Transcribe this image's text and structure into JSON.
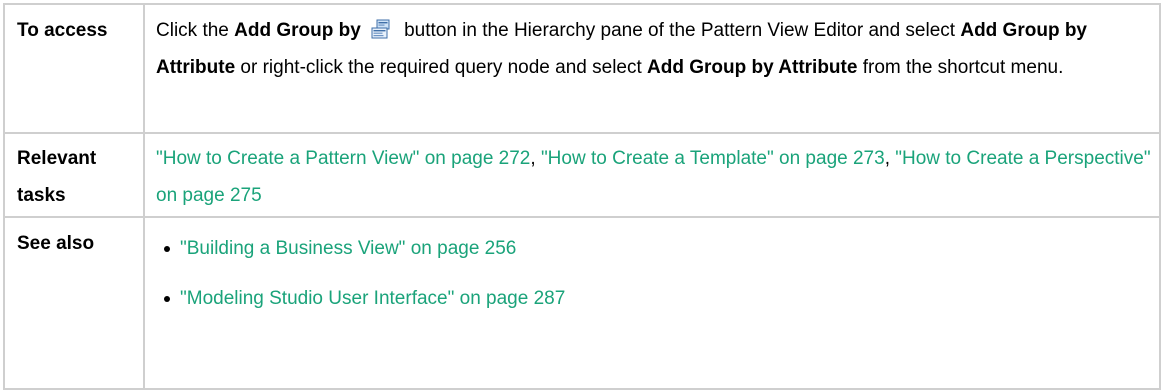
{
  "rows": [
    {
      "label": "To access",
      "parts": {
        "p1": "Click the ",
        "b1": "Add Group by",
        "icon": "add-group-by-icon",
        "p2": " button in the Hierarchy pane of the Pattern View Editor and select ",
        "b2": "Add Group by Attribute",
        "p3": " or right-click the required query node and select ",
        "b3": "Add Group by Attribute",
        "p4": " from the shortcut menu."
      }
    },
    {
      "label": "Relevant tasks",
      "links": [
        "\"How to Create a Pattern View\" on page 272",
        "\"How to Create a Template\" on page 273",
        "\"How to Create a Perspective\" on page 275"
      ],
      "separator": ", "
    },
    {
      "label": "See also",
      "items": [
        "\"Building a Business View\" on page 256",
        "\"Modeling Studio User Interface\" on page 287"
      ]
    }
  ],
  "colors": {
    "link": "#1aa37a",
    "border": "#cfcfcf"
  }
}
